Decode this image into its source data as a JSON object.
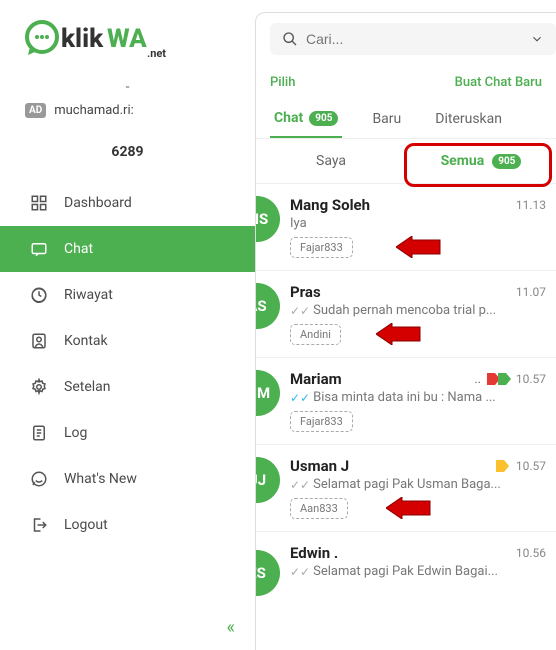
{
  "brand": {
    "name": "klikWA",
    "suffix": ".net"
  },
  "user": {
    "badge": "AD",
    "name": "muchamad.ri:",
    "phone": "6289"
  },
  "dash": "-",
  "nav": {
    "dashboard": "Dashboard",
    "chat": "Chat",
    "riwayat": "Riwayat",
    "kontak": "Kontak",
    "setelan": "Setelan",
    "log": "Log",
    "whatsnew": "What's New",
    "logout": "Logout"
  },
  "collapse_icon": "«",
  "search": {
    "placeholder": "Cari..."
  },
  "actions": {
    "pilih": "Pilih",
    "buat": "Buat Chat Baru"
  },
  "tabs1": {
    "chat": "Chat",
    "count": "905",
    "baru": "Baru",
    "diteruskan": "Diteruskan"
  },
  "tabs2": {
    "saya": "Saya",
    "semua": "Semua",
    "semua_count": "905"
  },
  "chats": [
    {
      "initials": "MS",
      "color": "#4CAF50",
      "name": "Mang Soleh",
      "time": "11.13",
      "msg": "Iya",
      "tag": "Fajar833",
      "ticks": "",
      "arrow": true
    },
    {
      "initials": "AS",
      "color": "#4CAF50",
      "name": "Pras",
      "time": "11.07",
      "msg": "Sudah pernah mencoba trial p...",
      "tag": "Andini",
      "ticks": "gray",
      "arrow": true
    },
    {
      "initials": "MM",
      "color": "#4CAF50",
      "name": "Mariam",
      "time": "10.57",
      "msg": "Bisa minta data ini bu : Nama ...",
      "tag": "Fajar833",
      "ticks": "blue",
      "dots": "..",
      "labels": [
        "red",
        "green"
      ]
    },
    {
      "initials": "UJ",
      "color": "#4CAF50",
      "name": "Usman J",
      "time": "10.57",
      "msg": "Selamat pagi Pak Usman Baga...",
      "tag": "Aan833",
      "ticks": "gray",
      "labels": [
        "yellow"
      ],
      "arrow": true
    },
    {
      "initials": "ES",
      "color": "#4CAF50",
      "name": "Edwin .",
      "time": "10.56",
      "msg": "Selamat pagi Pak Edwin Bagai...",
      "ticks": "gray"
    }
  ]
}
